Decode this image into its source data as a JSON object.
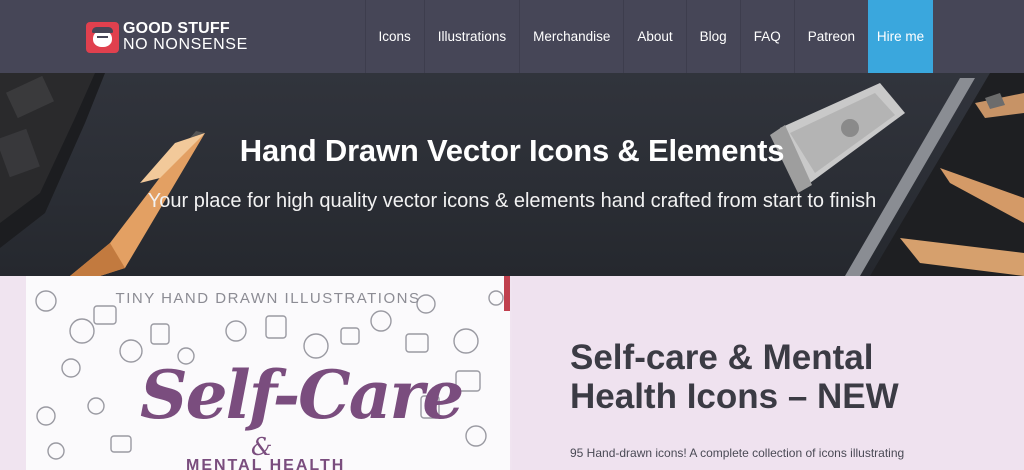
{
  "logo": {
    "line1": "GOOD STUFF",
    "line2": "NO NONSENSE",
    "icon": "logo-face-icon",
    "accent": "#e0404e"
  },
  "nav": {
    "items": [
      "Icons",
      "Illustrations",
      "Merchandise",
      "About",
      "Blog",
      "FAQ",
      "Patreon"
    ],
    "hire": "Hire me",
    "background": "#464657",
    "hire_color": "#3aa7dd"
  },
  "hero": {
    "title": "Hand Drawn Vector Icons & Elements",
    "subtitle": "Your place for high quality vector icons & elements hand crafted from start to finish"
  },
  "post": {
    "image": {
      "top_text": "TINY HAND DRAWN ILLUSTRATIONS",
      "title": "Self-Care",
      "amp": "&",
      "bottom_text": "MENTAL HEALTH"
    },
    "title": "Self-care & Mental Health Icons – NEW",
    "excerpt": "95 Hand-drawn icons! A complete collection of icons illustrating"
  }
}
